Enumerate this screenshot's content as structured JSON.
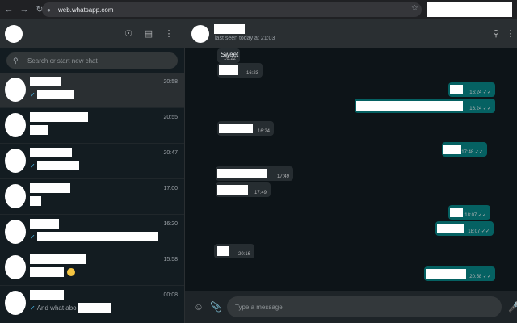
{
  "browser": {
    "url": "web.whatsapp.com",
    "back_icon": "back-arrow-icon",
    "forward_icon": "forward-arrow-icon",
    "reload_icon": "reload-icon",
    "star_icon": "bookmark-star-icon"
  },
  "left_header": {
    "icons": [
      "status-icon",
      "new-chat-icon",
      "menu-icon"
    ]
  },
  "search": {
    "placeholder": "Search or start new chat"
  },
  "chats": [
    {
      "time": "20:58",
      "preview": "",
      "tick": true,
      "active": true
    },
    {
      "time": "20:55",
      "preview": "",
      "tick": false
    },
    {
      "time": "20:47",
      "preview": "",
      "tick": true
    },
    {
      "time": "17:00",
      "preview": "",
      "tick": false
    },
    {
      "time": "16:20",
      "preview": "",
      "tick": true
    },
    {
      "time": "15:58",
      "preview": "",
      "tick": false,
      "emoji": true
    },
    {
      "time": "00:08",
      "preview": "And what abo",
      "tick": true
    }
  ],
  "conversation": {
    "status": "last seen today at 21:03",
    "messages": [
      {
        "dir": "in",
        "text": "Sweet",
        "time": "16:22"
      },
      {
        "dir": "in",
        "text": "",
        "time": "16:23"
      },
      {
        "dir": "out",
        "text": "",
        "time": "16:24"
      },
      {
        "dir": "out",
        "text": "",
        "time": "16:24"
      },
      {
        "dir": "in",
        "text": "",
        "time": "16:24"
      },
      {
        "dir": "out",
        "text": "",
        "time": "17:48"
      },
      {
        "dir": "in",
        "text": "",
        "time": "17:49"
      },
      {
        "dir": "in",
        "text": "",
        "time": "17:49"
      },
      {
        "dir": "out",
        "text": "",
        "time": "18:07"
      },
      {
        "dir": "out",
        "text": "",
        "time": "18:07"
      },
      {
        "dir": "in",
        "text": "",
        "time": "20:16"
      },
      {
        "dir": "out",
        "text": "",
        "time": "20:58"
      }
    ]
  },
  "composer": {
    "placeholder": "Type a message",
    "icons": [
      "emoji-icon",
      "attach-icon",
      "mic-icon"
    ]
  }
}
